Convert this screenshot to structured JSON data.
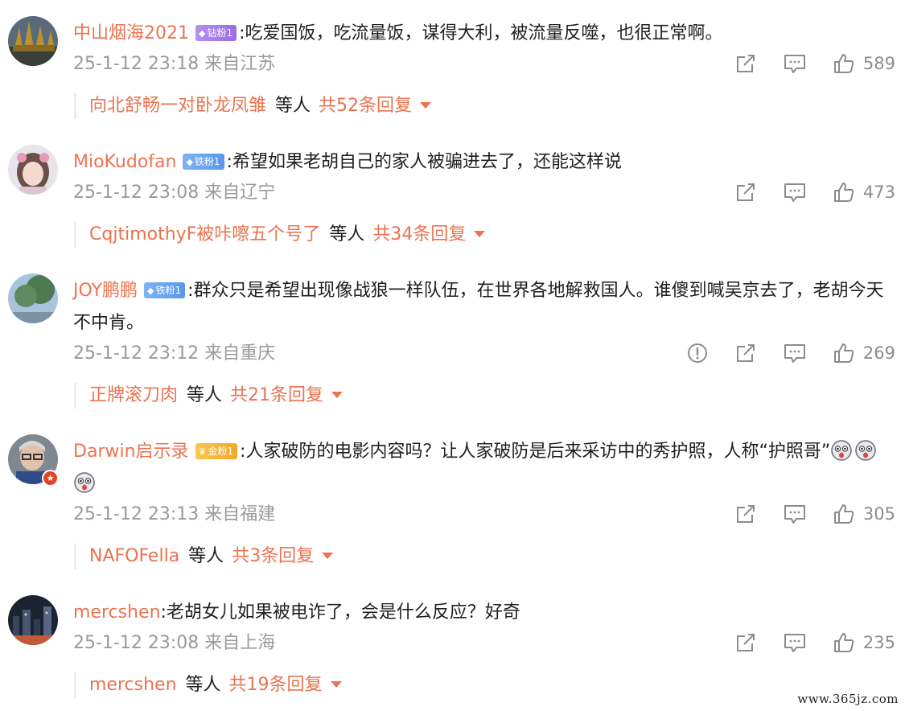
{
  "colors": {
    "accent": "#eb7350",
    "meta": "#9a9a9a",
    "text": "#1f1f1f",
    "icon": "#8c8c8c"
  },
  "comments": [
    {
      "user": "中山烟海2021",
      "badge": {
        "label": "钻粉1",
        "style": "purple",
        "icon": "diamond-icon"
      },
      "text": ":吃爱国饭，吃流量饭，谋得大利，被流量反噬，也很正常啊。",
      "emoji_count": 0,
      "meta": "25-1-12 23:18 来自江苏",
      "likes": "589",
      "has_report": false,
      "replies": {
        "names": "向北舒畅一对卧龙凤雏",
        "suffix": "等人",
        "total": "共52条回复"
      }
    },
    {
      "user": "MioKudofan",
      "badge": {
        "label": "铁粉1",
        "style": "blue",
        "icon": "diamond-icon"
      },
      "text": ":希望如果老胡自己的家人被骗进去了，还能这样说",
      "emoji_count": 0,
      "meta": "25-1-12 23:08 来自辽宁",
      "likes": "473",
      "has_report": false,
      "replies": {
        "names": "CqjtimothyF被咔嚓五个号了",
        "suffix": "等人",
        "total": "共34条回复"
      }
    },
    {
      "user": "JOY鹏鹏",
      "badge": {
        "label": "铁粉1",
        "style": "blue",
        "icon": "diamond-icon"
      },
      "text": ":群众只是希望出现像战狼一样队伍，在世界各地解救国人。谁傻到喊吴京去了，老胡今天不中肯。",
      "emoji_count": 0,
      "meta": "25-1-12 23:12 来自重庆",
      "likes": "269",
      "has_report": true,
      "replies": {
        "names": "正牌滚刀肉",
        "suffix": "等人",
        "total": "共21条回复"
      }
    },
    {
      "user": "Darwin启示录",
      "badge": {
        "label": "金粉1",
        "style": "gold",
        "icon": "crown-icon"
      },
      "text": ":人家破防的电影内容吗？让人家破防是后来采访中的秀护照，人称“护照哥”",
      "emoji_count": 3,
      "emoji_name": "shocked-face-emoji",
      "meta": "25-1-12 23:13 来自福建",
      "likes": "305",
      "has_report": false,
      "replies": {
        "names": "NAFOFella",
        "suffix": "等人",
        "total": "共3条回复"
      }
    },
    {
      "user": "mercshen",
      "badge": null,
      "text": ":老胡女儿如果被电诈了，会是什么反应？好奇",
      "emoji_count": 0,
      "meta": "25-1-12 23:08 来自上海",
      "likes": "235",
      "has_report": false,
      "replies": {
        "names": "mercshen",
        "suffix": "等人",
        "total": "共19条回复"
      }
    }
  ],
  "watermark": "www.365jz.com"
}
